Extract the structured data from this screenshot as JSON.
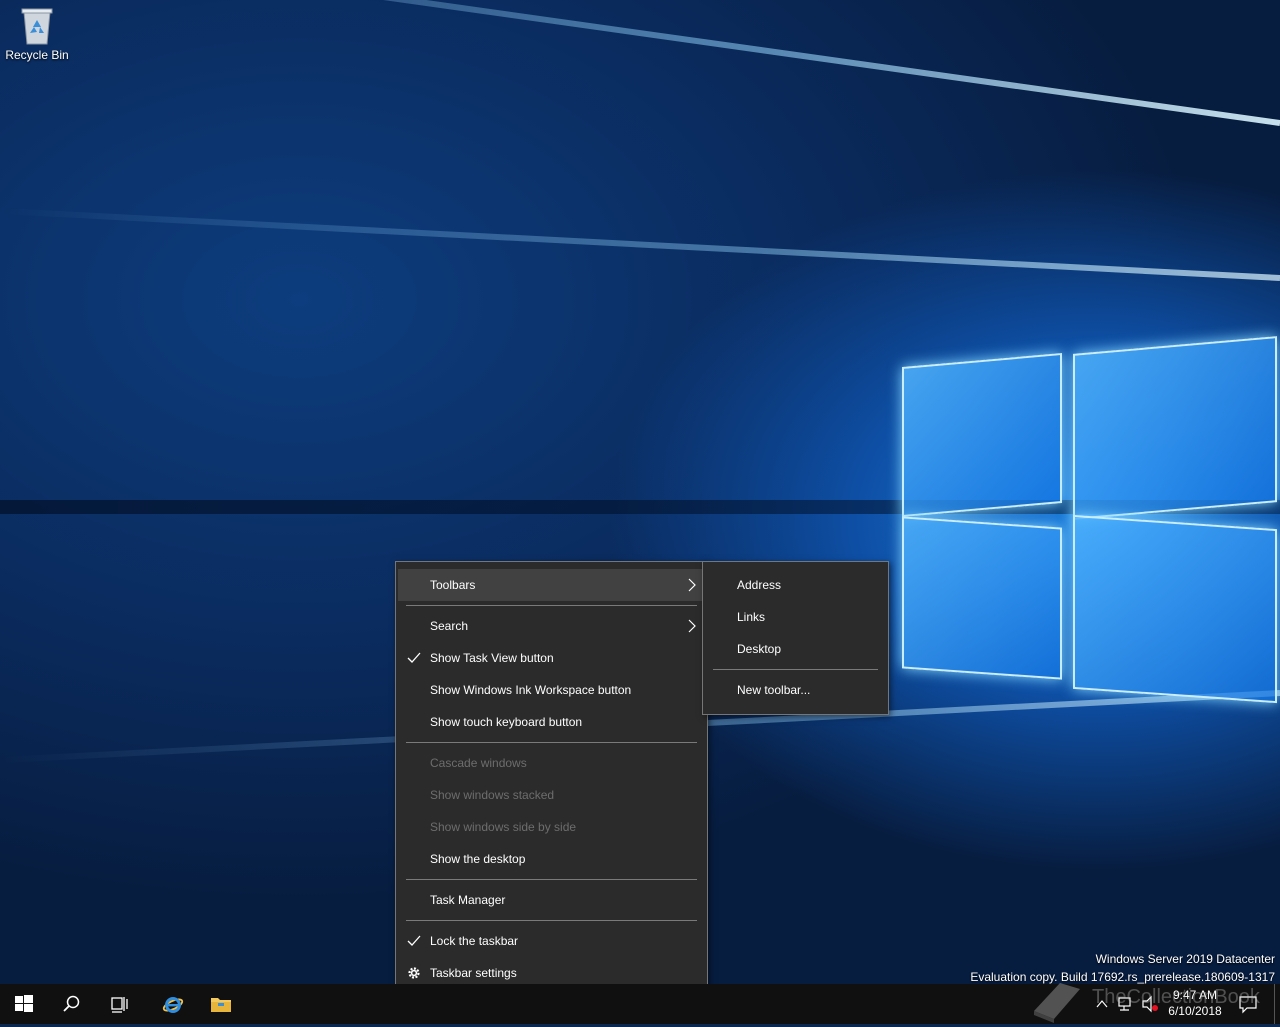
{
  "desktop": {
    "recycle_bin_label": "Recycle Bin",
    "watermark_line1": "Windows Server 2019 Datacenter",
    "watermark_line2": "Evaluation copy. Build 17692.rs_prerelease.180609-1317"
  },
  "context_menu": {
    "items": [
      {
        "label": "Toolbars",
        "submenu": true,
        "highlighted": true
      },
      {
        "label": "Search",
        "submenu": true
      },
      {
        "label": "Show Task View button",
        "checked": true
      },
      {
        "label": "Show Windows Ink Workspace button"
      },
      {
        "label": "Show touch keyboard button"
      },
      {
        "label": "Cascade windows",
        "disabled": true
      },
      {
        "label": "Show windows stacked",
        "disabled": true
      },
      {
        "label": "Show windows side by side",
        "disabled": true
      },
      {
        "label": "Show the desktop"
      },
      {
        "label": "Task Manager"
      },
      {
        "label": "Lock the taskbar",
        "checked": true
      },
      {
        "label": "Taskbar settings",
        "icon": "gear-icon"
      }
    ]
  },
  "toolbars_submenu": {
    "items": [
      {
        "label": "Address"
      },
      {
        "label": "Links"
      },
      {
        "label": "Desktop"
      },
      {
        "label": "New toolbar..."
      }
    ]
  },
  "taskbar": {
    "buttons": [
      {
        "name": "start-button",
        "icon": "windows-logo-icon"
      },
      {
        "name": "search-button",
        "icon": "search-icon"
      },
      {
        "name": "task-view-button",
        "icon": "task-view-icon"
      },
      {
        "name": "internet-explorer-button",
        "icon": "internet-explorer-icon"
      },
      {
        "name": "file-explorer-button",
        "icon": "folder-icon"
      }
    ],
    "clock_time": "9:47 AM",
    "clock_date": "6/10/2018",
    "overlay_text": "TheCollectionBook"
  },
  "colors": {
    "menu_bg": "#2b2b2b",
    "menu_hover": "#414141",
    "menu_border": "#767676",
    "disabled_text": "#6d6d6d",
    "taskbar_bg": "#101010"
  }
}
